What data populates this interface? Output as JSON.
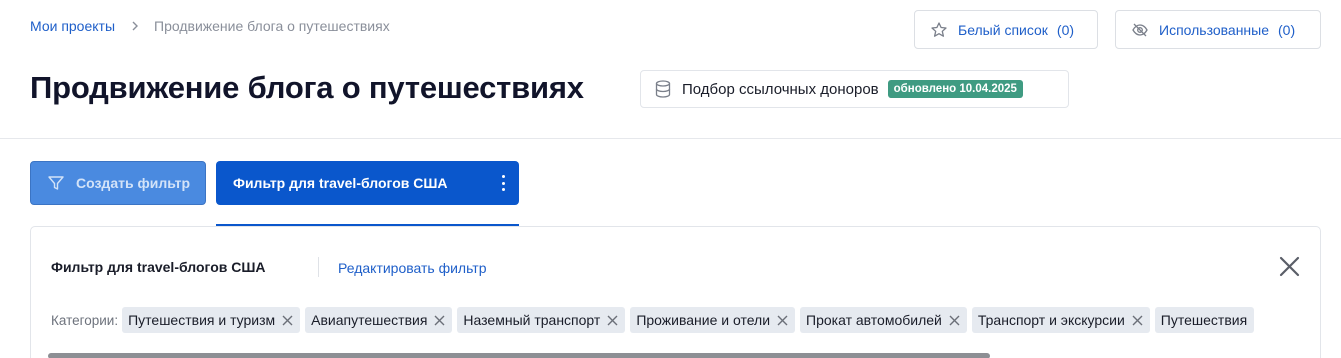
{
  "breadcrumb": {
    "root": "Мои проекты",
    "current": "Продвижение блога о путешествиях"
  },
  "top_actions": {
    "whitelist": {
      "label": "Белый список",
      "count": "(0)"
    },
    "used": {
      "label": "Использованные",
      "count": "(0)"
    }
  },
  "page_title": "Продвижение блога о путешествиях",
  "service": {
    "label": "Подбор ссылочных доноров",
    "badge": "обновлено 10.04.2025"
  },
  "filters": {
    "create_label": "Создать фильтр",
    "active_tab_label": "Фильтр для travel-блогов США"
  },
  "panel": {
    "title": "Фильтр для travel-блогов США",
    "edit_label": "Редактировать фильтр",
    "categories_label": "Категории:",
    "categories": [
      "Путешествия и туризм",
      "Авиапутешествия",
      "Наземный транспорт",
      "Проживание и отели",
      "Прокат автомобилей",
      "Транспорт и экскурсии",
      "Путешествия"
    ]
  },
  "colors": {
    "primary": "#0a57cc",
    "link": "#1f5fc9",
    "badge": "#3f9b82",
    "create_button": "#4a8ae0"
  },
  "icons": [
    "chevron-right-icon",
    "star-icon",
    "eye-off-icon",
    "database-icon",
    "filter-icon",
    "kebab-icon",
    "close-icon",
    "tag-remove-icon"
  ]
}
